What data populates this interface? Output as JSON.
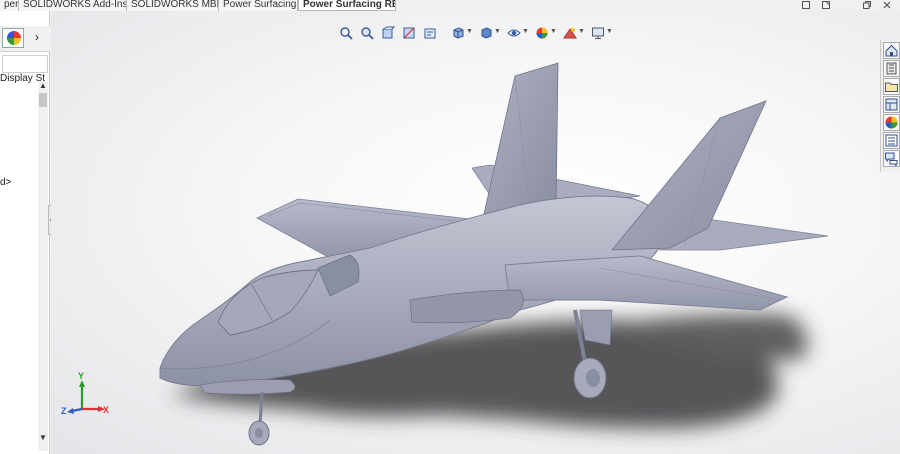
{
  "tabs": [
    {
      "label": "pert",
      "active": false
    },
    {
      "label": "SOLIDWORKS Add-Ins",
      "active": false
    },
    {
      "label": "SOLIDWORKS MBD",
      "active": false
    },
    {
      "label": "Power Surfacing",
      "active": false
    },
    {
      "label": "Power Surfacing RE",
      "active": true
    }
  ],
  "window_controls": [
    "restore-icon",
    "maximize-icon",
    "restore-down-icon",
    "close-icon"
  ],
  "left_panel": {
    "display_states_label": "Display St",
    "tree_item_fragment": "d>",
    "collapse_glyph": "«",
    "chevron": "›"
  },
  "heads_up_toolbar": [
    "zoom-to-fit-icon",
    "zoom-to-area-icon",
    "previous-view-icon",
    "section-view-icon",
    "dynamic-annotation-views-icon",
    "view-orientation-icon",
    "display-style-icon",
    "hide-show-items-icon",
    "edit-appearance-icon",
    "apply-scene-icon",
    "view-settings-icon"
  ],
  "task_pane": [
    "solidworks-resources-icon",
    "design-library-icon",
    "file-explorer-icon",
    "view-palette-icon",
    "appearances-scenes-icon",
    "custom-properties-icon",
    "forum-icon"
  ],
  "triad": {
    "y": "Y",
    "z": "Z",
    "x": "X"
  },
  "colors": {
    "model": "#9da1b3",
    "model_dark": "#6e7285",
    "shadow": "#3a3a3c",
    "accent_blue": "#2a5fbf"
  }
}
